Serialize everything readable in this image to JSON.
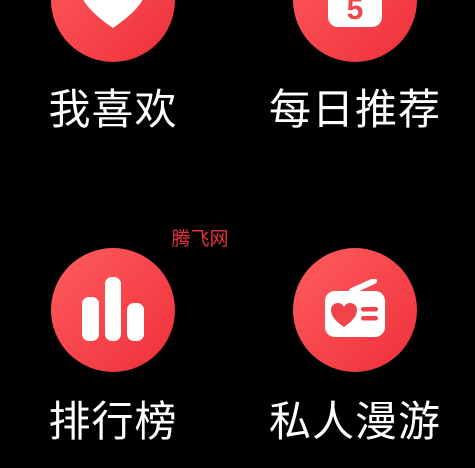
{
  "colors": {
    "background": "#000000",
    "accent_light": "#ff5d5d",
    "accent_dark": "#ef2f3a",
    "label": "#ffffff",
    "watermark": "#e8313a"
  },
  "tiles": [
    {
      "label": "我喜欢",
      "icon": "heart-icon"
    },
    {
      "label": "每日推荐",
      "icon": "calendar-icon",
      "icon_text": "5"
    },
    {
      "label": "排行榜",
      "icon": "bar-chart-icon"
    },
    {
      "label": "私人漫游",
      "icon": "radio-icon"
    }
  ],
  "watermark": "腾飞网"
}
